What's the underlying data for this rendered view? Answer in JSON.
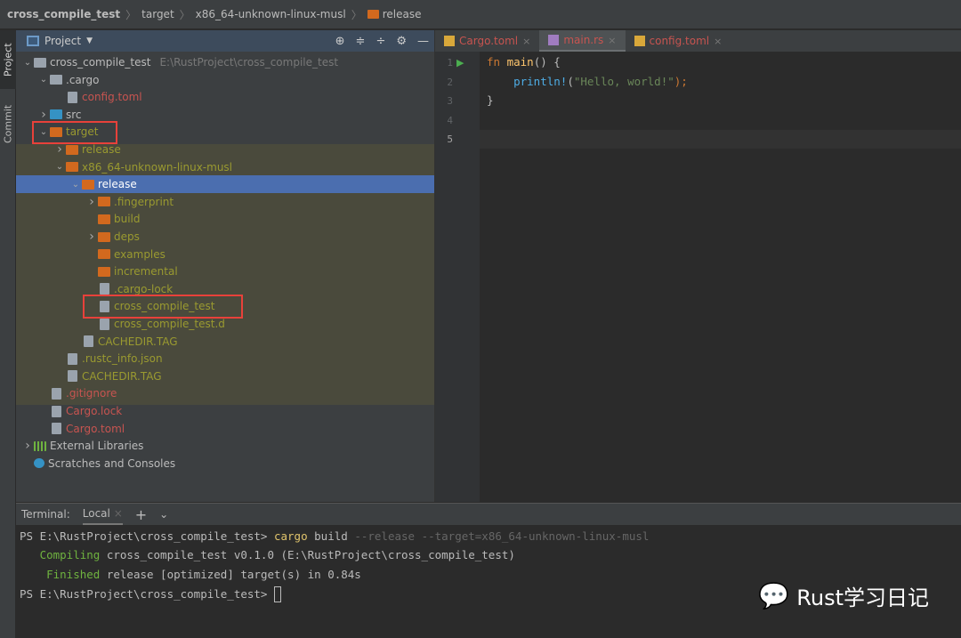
{
  "breadcrumb": [
    "cross_compile_test",
    "target",
    "x86_64-unknown-linux-musl",
    "release"
  ],
  "left_strip": {
    "project": "Project",
    "commit": "Commit"
  },
  "panel": {
    "title": "Project",
    "tools": [
      "locate-icon",
      "expand-all-icon",
      "collapse-all-icon",
      "gear-icon",
      "minimize-icon"
    ]
  },
  "tree": [
    {
      "label": "cross_compile_test",
      "level": 0,
      "type": "folder",
      "color": "#9aa3ad",
      "chev": "v",
      "text": "norm",
      "path": "E:\\RustProject\\cross_compile_test"
    },
    {
      "label": ".cargo",
      "level": 1,
      "type": "folder",
      "color": "#9aa3ad",
      "chev": "v",
      "text": "norm"
    },
    {
      "label": "config.toml",
      "level": 2,
      "type": "file",
      "text": "red"
    },
    {
      "label": "src",
      "level": 1,
      "type": "folder",
      "color": "#3592c4",
      "chev": ">",
      "text": "norm"
    },
    {
      "label": "target",
      "level": 1,
      "type": "folder",
      "color": "#d2691e",
      "chev": "v",
      "text": "olive"
    },
    {
      "label": "release",
      "level": 2,
      "type": "folder",
      "color": "#d2691e",
      "chev": ">",
      "text": "olive"
    },
    {
      "label": "x86_64-unknown-linux-musl",
      "level": 2,
      "type": "folder",
      "color": "#d2691e",
      "chev": "v",
      "text": "olive"
    },
    {
      "label": "release",
      "level": 3,
      "type": "folder",
      "color": "#d2691e",
      "chev": "v",
      "text": "white",
      "selected": true
    },
    {
      "label": ".fingerprint",
      "level": 4,
      "type": "folder",
      "color": "#d2691e",
      "chev": ">",
      "text": "olive"
    },
    {
      "label": "build",
      "level": 4,
      "type": "folder",
      "color": "#d2691e",
      "text": "olive"
    },
    {
      "label": "deps",
      "level": 4,
      "type": "folder",
      "color": "#d2691e",
      "chev": ">",
      "text": "olive"
    },
    {
      "label": "examples",
      "level": 4,
      "type": "folder",
      "color": "#d2691e",
      "text": "olive"
    },
    {
      "label": "incremental",
      "level": 4,
      "type": "folder",
      "color": "#d2691e",
      "text": "olive"
    },
    {
      "label": ".cargo-lock",
      "level": 4,
      "type": "file",
      "text": "olive"
    },
    {
      "label": "cross_compile_test",
      "level": 4,
      "type": "file",
      "text": "olive"
    },
    {
      "label": "cross_compile_test.d",
      "level": 4,
      "type": "file",
      "text": "olive"
    },
    {
      "label": "CACHEDIR.TAG",
      "level": 3,
      "type": "file",
      "text": "olive"
    },
    {
      "label": ".rustc_info.json",
      "level": 2,
      "type": "file",
      "text": "olive"
    },
    {
      "label": "CACHEDIR.TAG",
      "level": 2,
      "type": "file",
      "text": "olive"
    },
    {
      "label": ".gitignore",
      "level": 1,
      "type": "file",
      "text": "red"
    },
    {
      "label": "Cargo.lock",
      "level": 1,
      "type": "file",
      "text": "red"
    },
    {
      "label": "Cargo.toml",
      "level": 1,
      "type": "file",
      "text": "red"
    },
    {
      "label": "External Libraries",
      "level": 0,
      "type": "lib",
      "chev": ">",
      "text": "norm"
    },
    {
      "label": "Scratches and Consoles",
      "level": 0,
      "type": "scratch",
      "text": "norm"
    }
  ],
  "editor": {
    "tabs": [
      {
        "label": "Cargo.toml",
        "active": false
      },
      {
        "label": "main.rs",
        "active": true
      },
      {
        "label": "config.toml",
        "active": false
      }
    ],
    "line_numbers": [
      "1",
      "2",
      "3",
      "4",
      "5"
    ],
    "code": {
      "l1_kw": "fn",
      "l1_name": "main",
      "l1_rest": "() {",
      "l2_macro": "println!",
      "l2_open": "(",
      "l2_str": "\"Hello, world!\"",
      "l2_close": ");",
      "l3": "}"
    }
  },
  "terminal": {
    "label": "Terminal:",
    "tab": "Local",
    "prompt": "PS E:\\RustProject\\cross_compile_test> ",
    "cmd": "cargo",
    "cmd_arg": " build ",
    "cmd_flags": "--release --target=x86_64-unknown-linux-musl",
    "compiling_kw": "Compiling",
    "compiling_rest": " cross_compile_test v0.1.0 (E:\\RustProject\\cross_compile_test)",
    "finished_kw": "Finished",
    "finished_rest": " release [optimized] target(s) in 0.84s"
  },
  "watermark": "Rust学习日记",
  "colors": {
    "accent": "#4b6eaf",
    "highlight_box": "#e8413a",
    "excluded": "#d2691e"
  }
}
